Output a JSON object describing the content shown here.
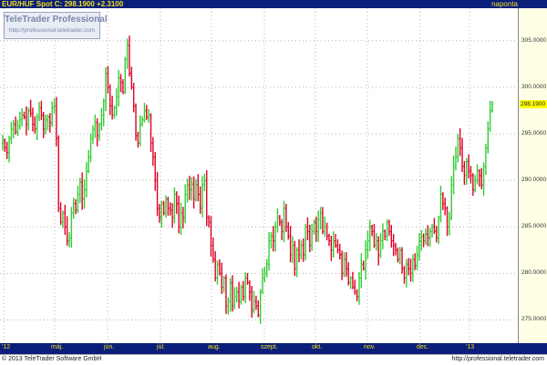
{
  "header": {
    "symbol_label": "EUR/HUF Spot C: 298.1900 +2.3100",
    "interval_label": "naponta"
  },
  "logo": {
    "brand": "TeleTrader Professional",
    "url": "http://professional.teletrader.com"
  },
  "footer": {
    "copyright": "© 2013 TeleTrader Software GmbH",
    "url": "http://professional.teletrader.com"
  },
  "colors": {
    "up": "#33cc33",
    "down": "#dd0022",
    "header_bg": "#0b1f7a",
    "header_text": "#f0e020",
    "last_price_bg": "#ffff00",
    "grid": "#b4b4b4"
  },
  "chart_data": {
    "type": "ohlc_bar",
    "ylim": [
      272.5,
      308.5
    ],
    "yticks": [
      "275.0000",
      "280.0000",
      "285.0000",
      "290.0000",
      "295.0000",
      "300.0000",
      "305.0000"
    ],
    "ytick_values": [
      275,
      280,
      285,
      290,
      295,
      300,
      305
    ],
    "last_price": 298.19,
    "last_price_label": "298.1900",
    "grid": true,
    "x_month_labels": [
      "'12",
      "máj.",
      "jún.",
      "júl.",
      "aug.",
      "szept.",
      "okt.",
      "nov.",
      "dec.",
      "'13"
    ],
    "start_close": 294.0,
    "closes": [
      294.2,
      293.5,
      293.0,
      294.5,
      295.5,
      296.0,
      295.2,
      295.8,
      296.5,
      297.0,
      296.8,
      296.0,
      297.5,
      297.2,
      296.0,
      295.5,
      296.8,
      297.8,
      297.0,
      295.5,
      296.5,
      296.8,
      296.2,
      297.8,
      298.0,
      294.5,
      287.0,
      285.5,
      286.5,
      285.0,
      283.5,
      283.8,
      286.5,
      287.5,
      286.8,
      288.5,
      289.8,
      288.0,
      289.0,
      291.0,
      292.5,
      294.5,
      295.5,
      296.2,
      294.8,
      296.0,
      297.0,
      298.5,
      301.5,
      300.0,
      298.0,
      297.0,
      297.8,
      299.0,
      301.0,
      300.5,
      299.5,
      303.0,
      304.5,
      301.5,
      300.0,
      298.0,
      294.8,
      294.0,
      296.0,
      296.5,
      297.5,
      296.8,
      297.0,
      294.0,
      292.5,
      290.0,
      287.0,
      286.0,
      287.5,
      286.5,
      288.0,
      287.0,
      286.8,
      286.0,
      288.5,
      287.5,
      285.0,
      286.5,
      286.0,
      288.5,
      289.5,
      289.0,
      289.6,
      288.0,
      289.5,
      288.5,
      287.0,
      289.5,
      290.0,
      286.0,
      285.5,
      283.0,
      281.5,
      279.5,
      281.0,
      280.0,
      278.5,
      279.5,
      276.5,
      277.0,
      279.0,
      276.5,
      277.5,
      278.0,
      277.0,
      278.5,
      277.5,
      279.5,
      279.0,
      278.0,
      276.0,
      277.0,
      276.5,
      275.5,
      278.0,
      279.5,
      280.0,
      281.0,
      283.5,
      284.0,
      283.5,
      285.0,
      286.0,
      285.5,
      284.5,
      287.0,
      285.0,
      284.0,
      282.0,
      283.0,
      280.5,
      282.5,
      282.0,
      283.0,
      282.0,
      285.0,
      284.5,
      283.0,
      284.5,
      285.5,
      284.5,
      285.8,
      286.5,
      284.5,
      285.0,
      284.0,
      283.5,
      282.5,
      283.5,
      283.0,
      282.5,
      282.0,
      280.0,
      281.5,
      280.5,
      279.0,
      279.5,
      278.5,
      278.0,
      277.5,
      279.5,
      281.0,
      280.5,
      282.5,
      283.5,
      285.0,
      284.5,
      283.0,
      283.5,
      282.0,
      283.5,
      284.5,
      284.0,
      285.5,
      284.5,
      283.5,
      283.0,
      282.5,
      281.5,
      282.5,
      280.5,
      279.5,
      281.0,
      280.5,
      280.0,
      281.5,
      280.8,
      282.0,
      283.5,
      284.0,
      283.5,
      284.2,
      283.8,
      284.5,
      285.0,
      284.5,
      283.8,
      286.0,
      288.5,
      287.5,
      287.0,
      285.0,
      286.0,
      289.5,
      291.5,
      292.5,
      294.5,
      293.5,
      291.5,
      290.5,
      292.0,
      291.0,
      290.5,
      289.0,
      290.0,
      291.0,
      290.5,
      289.5,
      291.5,
      293.5,
      295.5,
      297.5,
      298.19
    ]
  }
}
